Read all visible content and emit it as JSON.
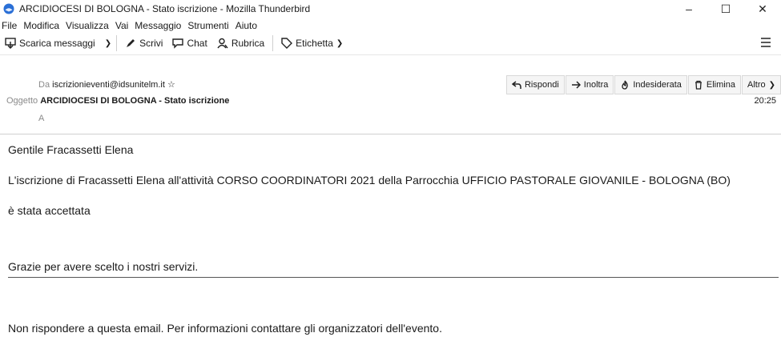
{
  "window": {
    "title": "ARCIDIOCESI DI BOLOGNA - Stato iscrizione - Mozilla Thunderbird",
    "minimize": "–",
    "maximize": "☐",
    "close": "✕"
  },
  "menu": [
    "File",
    "Modifica",
    "Visualizza",
    "Vai",
    "Messaggio",
    "Strumenti",
    "Aiuto"
  ],
  "toolbar": {
    "get_messages": "Scarica messaggi",
    "write": "Scrivi",
    "chat": "Chat",
    "address_book": "Rubrica",
    "tag": "Etichetta"
  },
  "header": {
    "from_label": "Da",
    "from_value": "iscrizionieventi@idsunitelm.it",
    "subject_label": "Oggetto",
    "subject_value": "ARCIDIOCESI DI BOLOGNA - Stato iscrizione",
    "to_label": "A",
    "time": "20:25",
    "reply": "Rispondi",
    "forward": "Inoltra",
    "junk": "Indesiderata",
    "delete": "Elimina",
    "more": "Altro"
  },
  "message": {
    "greeting": "Gentile Fracassetti Elena",
    "line1": "L'iscrizione di Fracassetti Elena all'attività CORSO COORDINATORI 2021 della Parrocchia UFFICIO PASTORALE GIOVANILE - BOLOGNA (BO)",
    "line2": "è stata accettata",
    "thanks": "Grazie per avere scelto i nostri servizi.",
    "footer": "Non rispondere a questa email. Per informazioni contattare gli organizzatori dell'evento."
  }
}
